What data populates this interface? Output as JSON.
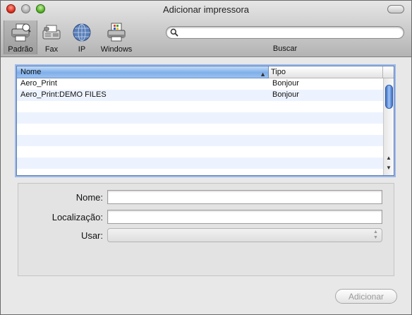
{
  "window": {
    "title": "Adicionar impressora"
  },
  "toolbar": {
    "items": [
      {
        "label": "Padrão",
        "icon": "default-printer-icon"
      },
      {
        "label": "Fax",
        "icon": "fax-icon"
      },
      {
        "label": "IP",
        "icon": "ip-globe-icon"
      },
      {
        "label": "Windows",
        "icon": "windows-printer-icon"
      }
    ],
    "selected": "Padrão",
    "search": {
      "value": "",
      "placeholder": "",
      "label": "Buscar"
    }
  },
  "printer_list": {
    "columns": [
      "Nome",
      "Tipo"
    ],
    "sort_column": "Nome",
    "rows": [
      {
        "name": "Aero_Print",
        "type": "Bonjour"
      },
      {
        "name": "Aero_Print:DEMO FILES",
        "type": "Bonjour"
      }
    ]
  },
  "form": {
    "name_label": "Nome:",
    "name_value": "",
    "location_label": "Localização:",
    "location_value": "",
    "use_label": "Usar:",
    "use_value": ""
  },
  "buttons": {
    "add_label": "Adicionar",
    "add_enabled": false
  },
  "colors": {
    "selected_header": "#7fb0ea",
    "row_stripe": "#edf3fe",
    "scroll_thumb": "#3b6ec4"
  }
}
